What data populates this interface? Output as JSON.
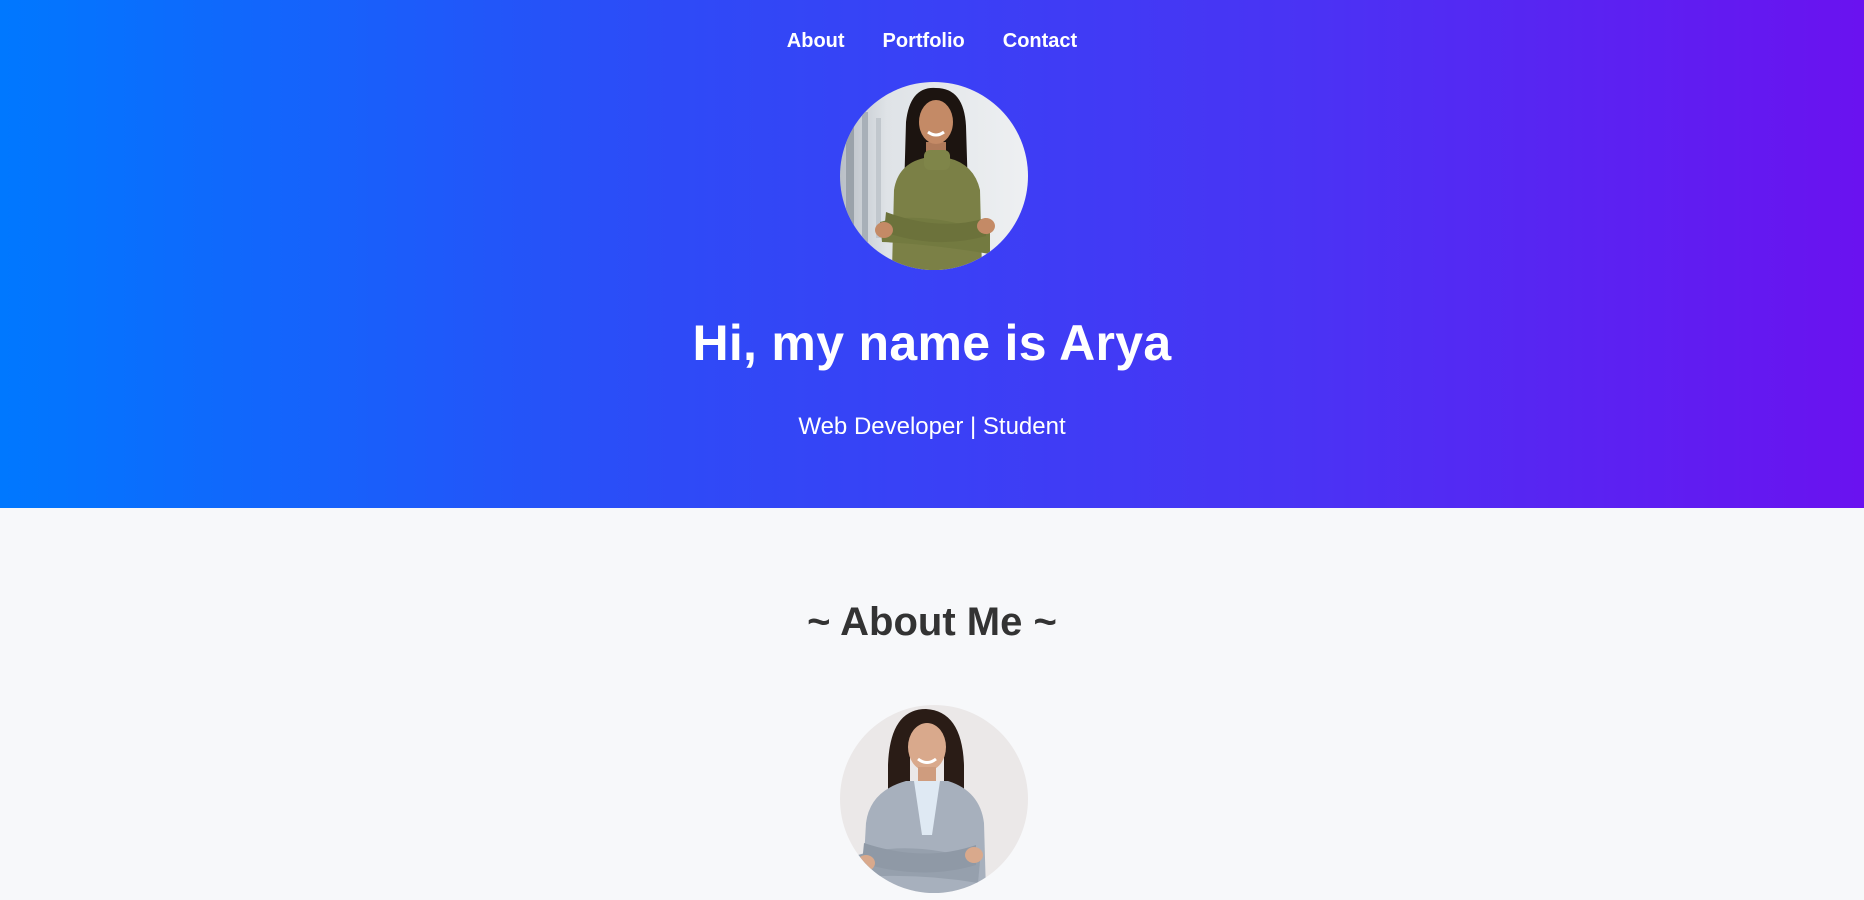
{
  "nav": {
    "items": [
      {
        "label": "About"
      },
      {
        "label": "Portfolio"
      },
      {
        "label": "Contact"
      }
    ]
  },
  "hero": {
    "title": "Hi, my name is Arya",
    "subtitle": "Web Developer | Student",
    "gradient": [
      "#0078ff",
      "#6a12f0"
    ]
  },
  "about": {
    "title": "~ About Me ~"
  },
  "colors": {
    "page_bg": "#f7f8fa",
    "heading_text": "#333333",
    "hero_text": "#ffffff"
  }
}
